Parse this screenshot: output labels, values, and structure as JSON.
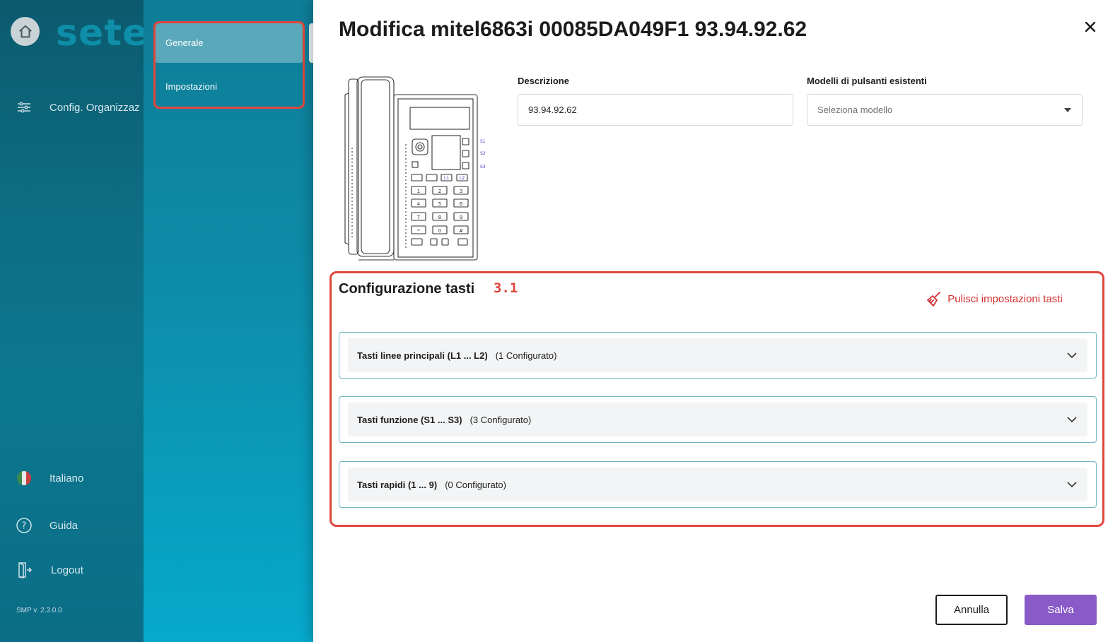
{
  "app": {
    "brand": "sete",
    "version": "SMP v. 2.3.0.0"
  },
  "sidebar": {
    "items": [
      {
        "label": "Config. Organizzaz",
        "icon": "sliders-icon"
      },
      {
        "label": "Italiano",
        "icon": "italy-flag-icon"
      },
      {
        "label": "Guida",
        "icon": "help-icon"
      },
      {
        "label": "Logout",
        "icon": "logout-icon"
      }
    ]
  },
  "subnav": {
    "items": [
      {
        "label": "Generale",
        "active": true
      },
      {
        "label": "Impostazioni",
        "active": false
      }
    ]
  },
  "page": {
    "title": "Modifica mitel6863i 00085DA049F1 93.94.92.62"
  },
  "form": {
    "description_label": "Descrizione",
    "description_value": "93.94.92.62",
    "models_label": "Modelli di pulsanti esistenti",
    "models_placeholder": "Seleziona modello"
  },
  "keys_config": {
    "title": "Configurazione tasti",
    "annotation": "3.1",
    "clear_label": "Pulisci impostazioni tasti",
    "sections": [
      {
        "title": "Tasti linee principali (L1 ... L2)",
        "count": "(1 Configurato)"
      },
      {
        "title": "Tasti funzione (S1 ... S3)",
        "count": "(3 Configurato)"
      },
      {
        "title": "Tasti rapidi (1 ... 9)",
        "count": "(0 Configurato)"
      }
    ]
  },
  "phone_labels": {
    "s1": "S1",
    "s2": "S2",
    "s3": "S3",
    "l1": "L1",
    "l2": "L2",
    "keys": [
      "1",
      "2",
      "3",
      "4",
      "5",
      "6",
      "7",
      "8",
      "9",
      "*",
      "0",
      "#"
    ]
  },
  "actions": {
    "cancel": "Annulla",
    "save": "Salva"
  },
  "colors": {
    "accent": "#8a5ac8",
    "highlight": "#e0463c",
    "sidebar": "#0b6d86",
    "subnav": "#0e8aa6"
  }
}
